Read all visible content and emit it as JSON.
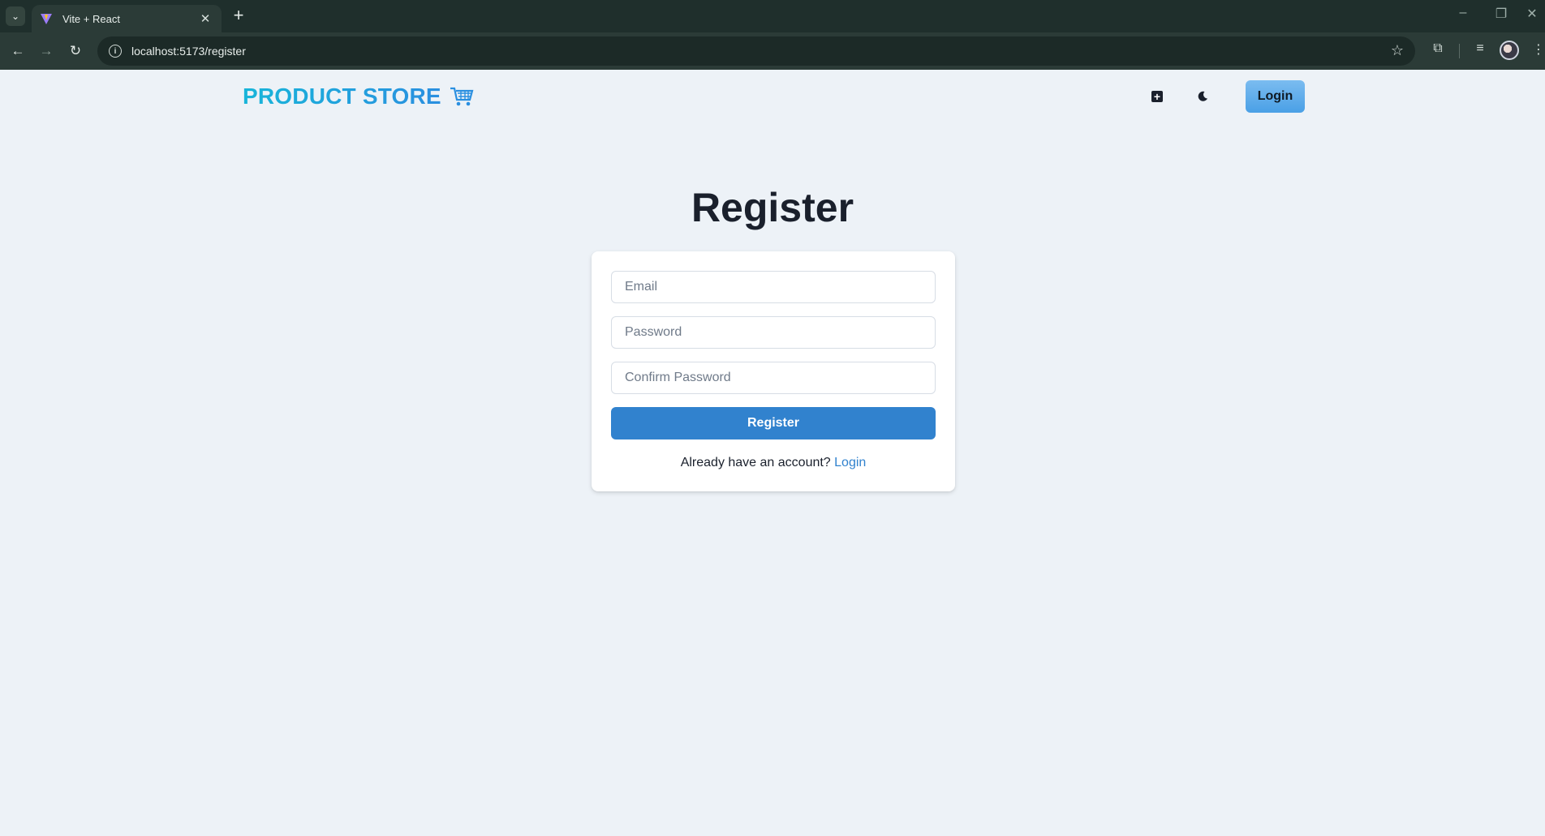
{
  "browser": {
    "tab_title": "Vite + React",
    "url": "localhost:5173/register"
  },
  "navbar": {
    "brand_text": "PRODUCT STORE",
    "brand_icon": "shopping-cart-icon",
    "create_icon": "plus-square-icon",
    "theme_icon": "moon-icon",
    "login_label": "Login"
  },
  "register": {
    "title": "Register",
    "email_placeholder": "Email",
    "password_placeholder": "Password",
    "confirm_placeholder": "Confirm Password",
    "submit_label": "Register",
    "footer_text": "Already have an account?",
    "footer_link": "Login"
  },
  "colors": {
    "page_bg": "#edf2f7",
    "primary": "#3182ce",
    "brand": "#19a7dd",
    "chrome": "#1f2f2c"
  }
}
